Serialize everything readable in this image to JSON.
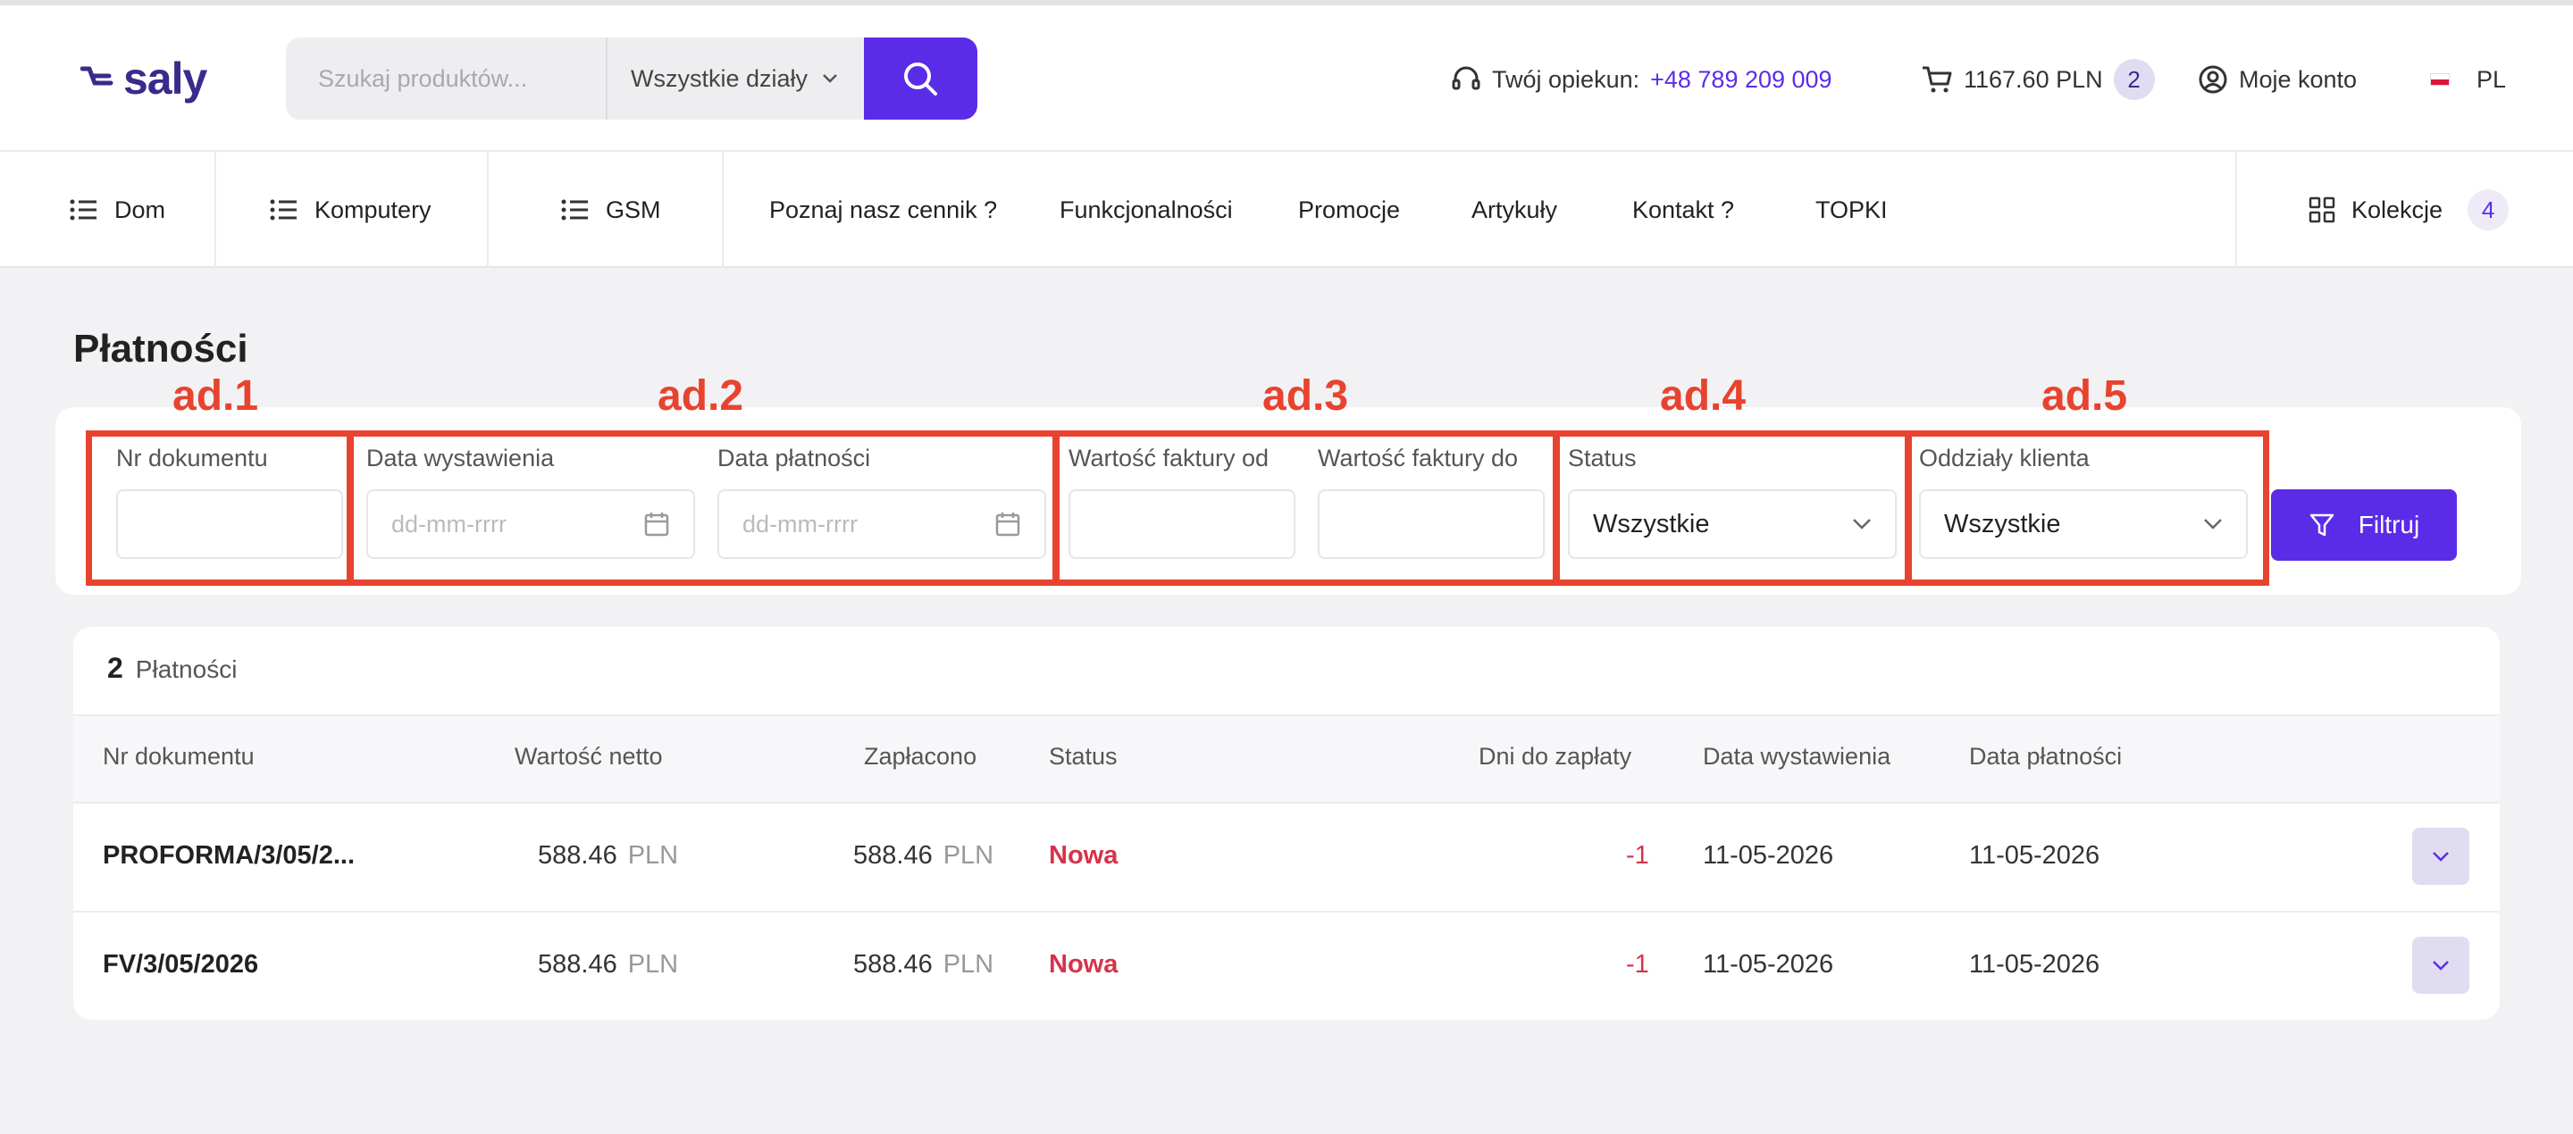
{
  "header": {
    "logo_text": "saly",
    "search": {
      "placeholder": "Szukaj produktów...",
      "category": "Wszystkie działy"
    },
    "advisor_label": "Twój opiekun:",
    "advisor_phone": "+48 789 209 009",
    "cart_total": "1167.60 PLN",
    "cart_count": "2",
    "account_label": "Moje konto",
    "language": "PL"
  },
  "nav": {
    "categories": [
      "Dom",
      "Komputery",
      "GSM"
    ],
    "links": [
      "Poznaj nasz cennik ?",
      "Funkcjonalności",
      "Promocje",
      "Artykuły",
      "Kontakt ?",
      "TOPKI"
    ],
    "collections_label": "Kolekcje",
    "collections_count": "4"
  },
  "page": {
    "title": "Płatności"
  },
  "annotations": [
    "ad.1",
    "ad.2",
    "ad.3",
    "ad.4",
    "ad.5"
  ],
  "filters": {
    "doc_number_label": "Nr dokumentu",
    "issue_date_label": "Data wystawienia",
    "issue_date_placeholder": "dd-mm-rrrr",
    "payment_date_label": "Data płatności",
    "payment_date_placeholder": "dd-mm-rrrr",
    "value_from_label": "Wartość faktury od",
    "value_to_label": "Wartość faktury do",
    "status_label": "Status",
    "status_value": "Wszystkie",
    "branches_label": "Oddziały klienta",
    "branches_value": "Wszystkie",
    "filter_button": "Filtruj"
  },
  "table": {
    "count": "2",
    "count_label": "Płatności",
    "columns": [
      "Nr dokumentu",
      "Wartość netto",
      "Zapłacono",
      "Status",
      "Dni do zapłaty",
      "Data wystawienia",
      "Data płatności"
    ],
    "rows": [
      {
        "doc": "PROFORMA/3/05/2...",
        "net": "588.46",
        "net_cur": "PLN",
        "paid": "588.46",
        "paid_cur": "PLN",
        "status": "Nowa",
        "days": "-1",
        "issue_date": "11-05-2026",
        "payment_date": "11-05-2026"
      },
      {
        "doc": "FV/3/05/2026",
        "net": "588.46",
        "net_cur": "PLN",
        "paid": "588.46",
        "paid_cur": "PLN",
        "status": "Nowa",
        "days": "-1",
        "issue_date": "11-05-2026",
        "payment_date": "11-05-2026"
      }
    ]
  },
  "colors": {
    "accent": "#5b2ce8",
    "annotation": "#e8432f",
    "status_new": "#d6334a"
  }
}
